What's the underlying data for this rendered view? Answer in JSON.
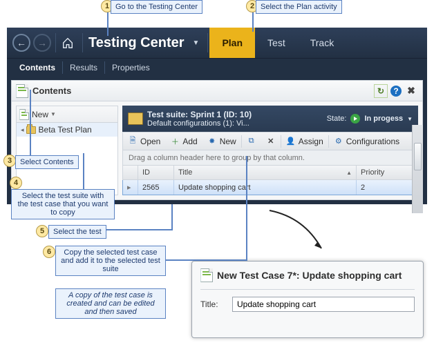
{
  "callouts": {
    "n1": "1",
    "t1": "Go to the Testing Center",
    "n2": "2",
    "t2": "Select the Plan activity",
    "n3": "3",
    "t3": "Select Contents",
    "n4": "4",
    "t4": "Select the test suite with the test case that you want to copy",
    "n5": "5",
    "t5": "Select the test",
    "n6": "6",
    "t6": "Copy the selected test case and add it to the selected test suite",
    "note": "A copy of the test case is created and can be edited and then saved"
  },
  "titlebar": {
    "brand": "Testing Center",
    "tabs": {
      "plan": "Plan",
      "test": "Test",
      "track": "Track"
    }
  },
  "subtabs": {
    "contents": "Contents",
    "results": "Results",
    "properties": "Properties"
  },
  "panel": {
    "title": "Contents"
  },
  "tree": {
    "new_button": "New",
    "item1": "Beta Test Plan"
  },
  "suite": {
    "title": "Test suite:  Sprint 1 (ID: 10)",
    "subtitle": "Default configurations (1): Vi...",
    "state_label": "State:",
    "state_value": "In progess"
  },
  "toolbar": {
    "open": "Open",
    "add": "Add",
    "new": "New",
    "assign": "Assign",
    "configurations": "Configurations"
  },
  "grid": {
    "hint": "Drag a column header here to group by that column.",
    "hdr_id": "ID",
    "hdr_title": "Title",
    "hdr_priority": "Priority",
    "row1_id": "2565",
    "row1_title": "Update shopping cart",
    "row1_priority": "2"
  },
  "inset": {
    "title": "New Test Case 7*: Update shopping cart",
    "field_label": "Title:",
    "field_value": "Update shopping cart"
  }
}
